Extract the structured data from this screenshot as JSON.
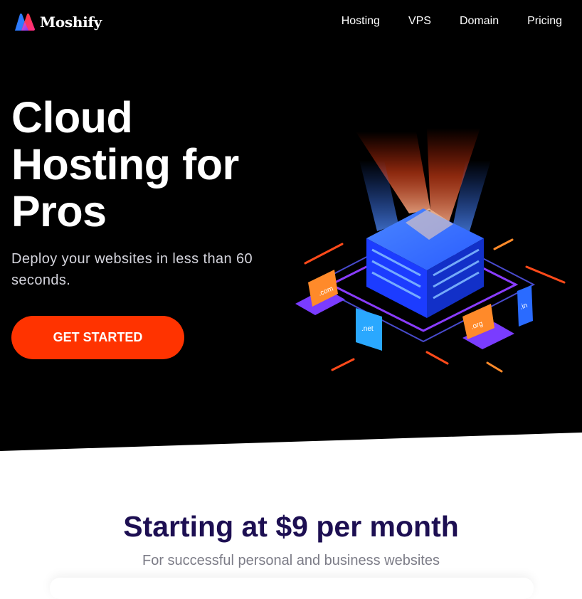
{
  "brand": {
    "name": "Moshify"
  },
  "nav": {
    "items": [
      "Hosting",
      "VPS",
      "Domain",
      "Pricing"
    ]
  },
  "hero": {
    "title_lines": [
      "Cloud",
      "Hosting for",
      "Pros"
    ],
    "subtitle": "Deploy your websites in less than 60 seconds.",
    "cta_label": "GET STARTED",
    "illustration": {
      "domain_labels": [
        ".com",
        ".net",
        ".org",
        ".in"
      ]
    }
  },
  "pricing": {
    "title": "Starting at $9 per month",
    "subtitle": "For successful personal and business websites"
  },
  "colors": {
    "hero_background": "#000000",
    "cta": "#ff3300",
    "pricing_title": "#1d0f52",
    "subtle_text": "#7c7c87"
  }
}
